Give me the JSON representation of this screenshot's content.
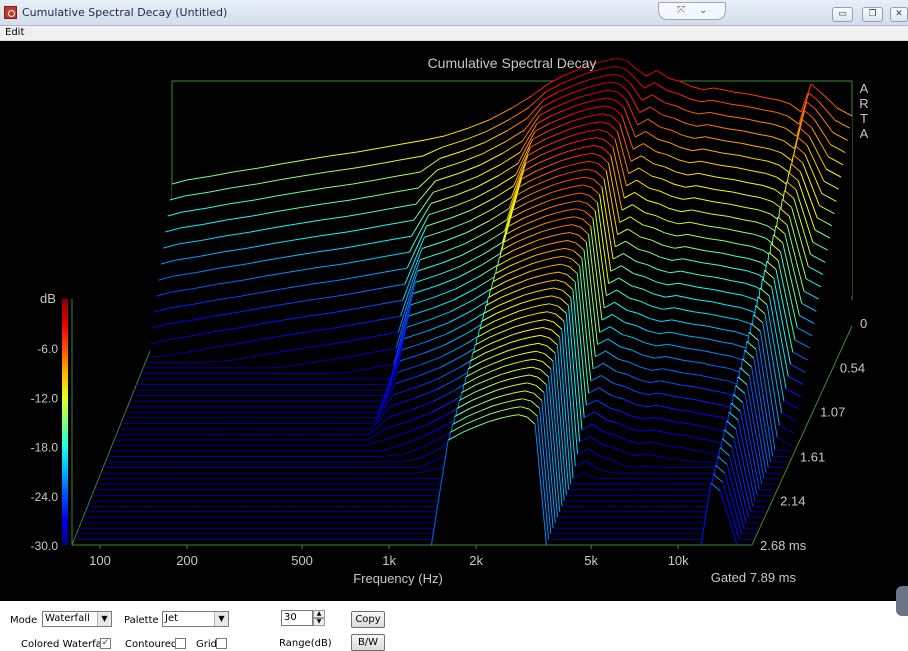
{
  "window": {
    "title": "Cumulative Spectral Decay  (Untitled)",
    "pill_icons": [
      "expand-icon",
      "chevron-down-icon"
    ],
    "buttons": [
      "minimize-icon",
      "restore-icon",
      "close-icon"
    ]
  },
  "menu": {
    "edit": "Edit"
  },
  "chart_data": {
    "type": "waterfall",
    "title": "Cumulative Spectral Decay",
    "xlabel": "Frequency (Hz)",
    "x_scale": "log",
    "x_ticks": [
      100,
      200,
      500,
      1000,
      2000,
      5000,
      10000
    ],
    "x_tick_labels": [
      "100",
      "200",
      "500",
      "1k",
      "2k",
      "5k",
      "10k"
    ],
    "xlim": [
      80,
      18000
    ],
    "z_ticks": [
      0,
      0.54,
      1.07,
      1.61,
      2.14,
      2.68
    ],
    "z_tick_labels": [
      "0",
      "0.54",
      "1.07",
      "1.61",
      "2.14",
      "2.68 ms"
    ],
    "zlim": [
      0,
      2.68
    ],
    "ylabel": "dB",
    "y_ticks": [
      -6,
      -12,
      -18,
      -24,
      -30
    ],
    "y_tick_labels": [
      "-6.0",
      "-12.0",
      "-18.0",
      "-24.0",
      "-30.0"
    ],
    "ylim": [
      -30,
      0
    ],
    "annotation": "Gated 7.89 ms",
    "watermark": "ARTA",
    "palette": "jet",
    "slice_count": 46,
    "spectrum_freqs": [
      80,
      90,
      110,
      130,
      160,
      190,
      230,
      280,
      350,
      420,
      500,
      600,
      700,
      850,
      1000,
      1200,
      1400,
      1600,
      1800,
      2000,
      2200,
      2400,
      2600,
      2800,
      3000,
      3200,
      3500,
      3800,
      4200,
      4600,
      5000,
      5500,
      6000,
      7000,
      8000,
      9000,
      10000,
      11000,
      12000,
      13000,
      14000,
      16000,
      18000
    ],
    "initial_level_db": [
      -16,
      -15.5,
      -15,
      -14.5,
      -14,
      -13.5,
      -13,
      -12.5,
      -12,
      -11.5,
      -11,
      -10.5,
      -10,
      -9,
      -8,
      -6.5,
      -5,
      -3.5,
      -2.5,
      -1.8,
      -1.2,
      -0.8,
      -0.5,
      -0.3,
      -0.6,
      -1.5,
      -2.5,
      -1.8,
      -2.8,
      -3.2,
      -3.8,
      -4.2,
      -4,
      -4.5,
      -4.8,
      -5.2,
      -5.5,
      -6,
      -7,
      -3.5,
      -4.5,
      -6.5,
      -7.5
    ]
  },
  "controls": {
    "mode_label": "Mode",
    "mode_value": "Waterfall",
    "palette_label": "Palette",
    "palette_value": "Jet",
    "range_value": "30",
    "range_label": "Range(dB)",
    "copy_label": "Copy",
    "bw_label": "B/W",
    "colored_waterfall_label": "Colored Waterfall",
    "colored_waterfall_checked": "✓",
    "contoured_label": "Contoured",
    "grid_label": "Grid",
    "spin_up": "▲",
    "spin_down": "▼",
    "combo_arrow": "▼"
  }
}
